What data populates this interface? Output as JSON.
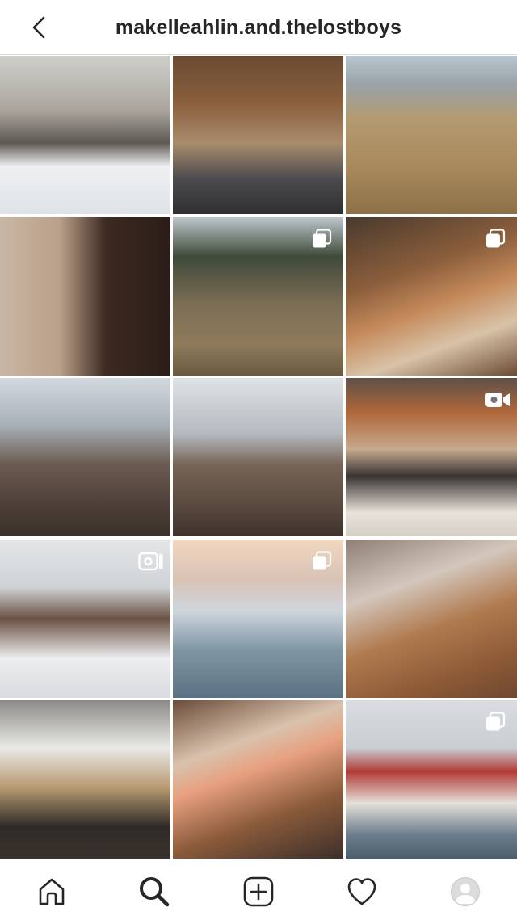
{
  "header": {
    "username": "makelleahlin.and.thelostboys",
    "back_icon": "chevron-left-icon"
  },
  "grid": {
    "tiles": [
      {
        "index": 0,
        "badge": null
      },
      {
        "index": 1,
        "badge": null
      },
      {
        "index": 2,
        "badge": null
      },
      {
        "index": 3,
        "badge": null
      },
      {
        "index": 4,
        "badge": "carousel-icon"
      },
      {
        "index": 5,
        "badge": "carousel-icon"
      },
      {
        "index": 6,
        "badge": null
      },
      {
        "index": 7,
        "badge": null
      },
      {
        "index": 8,
        "badge": "video-icon"
      },
      {
        "index": 9,
        "badge": "igtv-icon"
      },
      {
        "index": 10,
        "badge": "carousel-icon"
      },
      {
        "index": 11,
        "badge": null
      },
      {
        "index": 12,
        "badge": null
      },
      {
        "index": 13,
        "badge": null
      },
      {
        "index": 14,
        "badge": "carousel-icon"
      }
    ]
  },
  "navbar": {
    "items": [
      {
        "id": "home",
        "icon": "home-icon",
        "active": false
      },
      {
        "id": "search",
        "icon": "search-icon",
        "active": true
      },
      {
        "id": "new-post",
        "icon": "add-post-icon",
        "active": false
      },
      {
        "id": "activity",
        "icon": "heart-icon",
        "active": false
      },
      {
        "id": "profile",
        "icon": "avatar-icon",
        "active": false
      }
    ]
  },
  "colors": {
    "text": "#262626",
    "divider": "#dbdbdb",
    "background": "#ffffff"
  }
}
